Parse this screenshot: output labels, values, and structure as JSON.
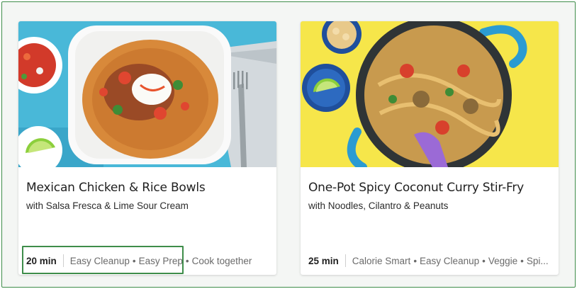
{
  "recipes": [
    {
      "title": "Mexican Chicken & Rice Bowls",
      "subtitle": "with Salsa Fresca & Lime Sour Cream",
      "time": "20 min",
      "tags": [
        "Easy Cleanup",
        "Easy Prep",
        "Cook together"
      ]
    },
    {
      "title": "One-Pot Spicy Coconut Curry Stir-Fry",
      "subtitle": "with Noodles, Cilantro & Peanuts",
      "time": "25 min",
      "tags": [
        "Calorie Smart",
        "Easy Cleanup",
        "Veggie",
        "Spi..."
      ]
    }
  ],
  "colors": {
    "highlight": "#3e8d4a",
    "photo1_background": "#49b8d8",
    "photo2_background": "#f6e64a"
  }
}
